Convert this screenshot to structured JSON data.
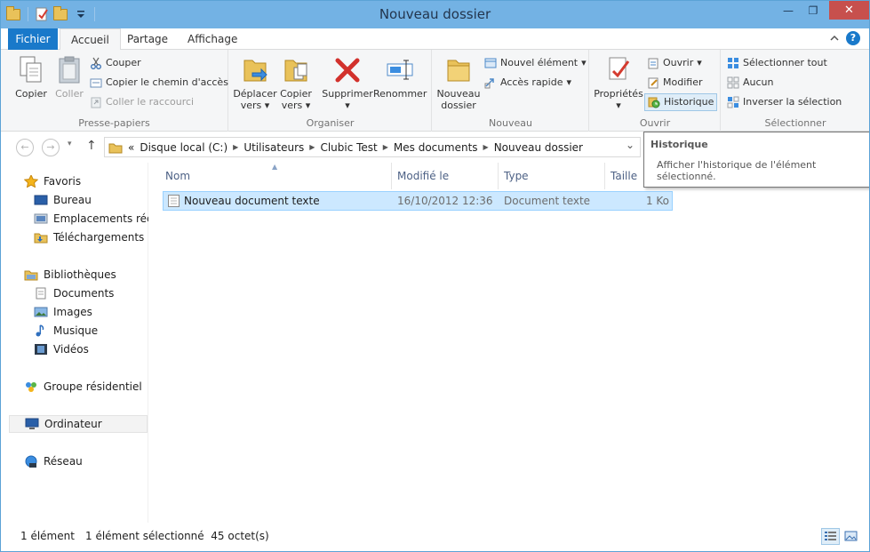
{
  "window": {
    "title": "Nouveau dossier",
    "minimize": "—",
    "maximize": "❐",
    "close": "✕"
  },
  "ribbon_tabs": [
    {
      "label": "Fichier"
    },
    {
      "label": "Accueil"
    },
    {
      "label": "Partage"
    },
    {
      "label": "Affichage"
    }
  ],
  "ribbon": {
    "presse_papiers": {
      "label": "Presse-papiers",
      "copier": "Copier",
      "coller": "Coller",
      "couper": "Couper",
      "copier_chemin": "Copier le chemin d'accès",
      "coller_raccourci": "Coller le raccourci"
    },
    "organiser": {
      "label": "Organiser",
      "deplacer_1": "Déplacer",
      "deplacer_2": "vers",
      "copier_1": "Copier",
      "copier_2": "vers",
      "supprimer": "Supprimer",
      "renommer": "Renommer"
    },
    "nouveau": {
      "label": "Nouveau",
      "nouveau_dossier_1": "Nouveau",
      "nouveau_dossier_2": "dossier",
      "nouvel_element": "Nouvel élément",
      "acces_rapide": "Accès rapide"
    },
    "ouvrir": {
      "label": "Ouvrir",
      "proprietes": "Propriétés",
      "ouvrir": "Ouvrir",
      "modifier": "Modifier",
      "historique": "Historique"
    },
    "selectionner": {
      "label": "Sélectionner",
      "tout": "Sélectionner tout",
      "aucun": "Aucun",
      "inverser": "Inverser la sélection"
    },
    "dropdown_arrow": "▾"
  },
  "address": {
    "back": "←",
    "forward": "→",
    "up": "↑",
    "overflow": "«",
    "breadcrumb": [
      "Disque local (C:)",
      "Utilisateurs",
      "Clubic Test",
      "Mes documents",
      "Nouveau dossier"
    ],
    "dropdown": "⌄"
  },
  "nav_pane": {
    "favoris": {
      "label": "Favoris",
      "items": [
        "Bureau",
        "Emplacements récents",
        "Téléchargements"
      ]
    },
    "bibliotheques": {
      "label": "Bibliothèques",
      "items": [
        "Documents",
        "Images",
        "Musique",
        "Vidéos"
      ]
    },
    "groupe": "Groupe résidentiel",
    "ordinateur": "Ordinateur",
    "reseau": "Réseau"
  },
  "columns": [
    "Nom",
    "Modifié le",
    "Type",
    "Taille"
  ],
  "files": [
    {
      "name": "Nouveau document texte",
      "modified": "16/10/2012 12:36",
      "type": "Document texte",
      "size": "1 Ko"
    }
  ],
  "tooltip": {
    "title": "Historique",
    "line1": "Afficher l'historique de l'élément",
    "line2": "sélectionné."
  },
  "status": {
    "count": "1 élément",
    "selection": "1 élément sélectionné  45 octet(s)"
  },
  "colors": {
    "title_bar": "#73b2e4",
    "file_tab": "#1979ca",
    "selection": "#cce8ff",
    "close": "#c7504d"
  }
}
